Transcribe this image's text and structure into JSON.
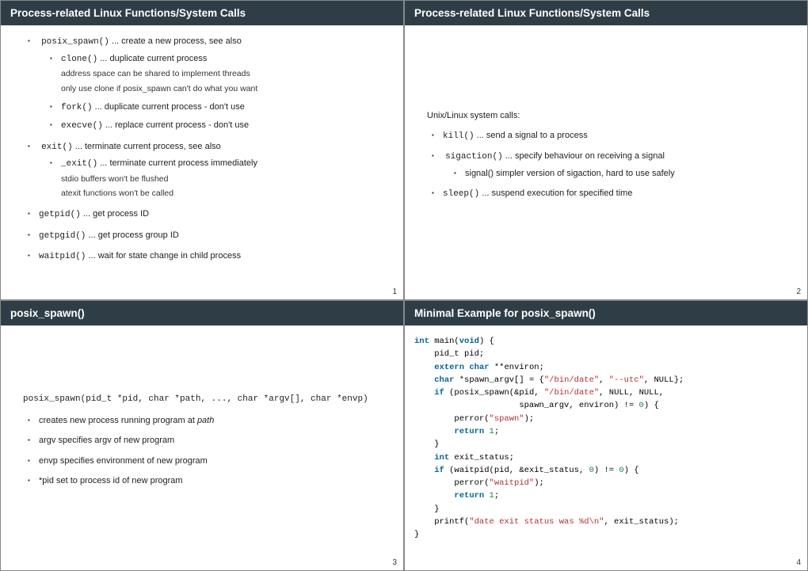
{
  "slide1": {
    "title": "Process-related Linux Functions/System Calls",
    "pagenum": "1",
    "i1_fn": "posix_spawn()",
    "i1_rest": " ... create a new process, see also",
    "i1a_fn": "clone()",
    "i1a_rest": " ... duplicate current process",
    "i1a_n1": "address space can be shared to implement threads",
    "i1a_n2": "only use clone if posix_spawn can't do what you want",
    "i1b_fn": "fork()",
    "i1b_rest": " ... duplicate current process - don't use",
    "i1c_fn": "execve()",
    "i1c_rest": " ... replace current process - don't use",
    "i2_fn": "exit()",
    "i2_rest": " ... terminate current process, see also",
    "i2a_fn": "_exit()",
    "i2a_rest": " ... terminate current process immediately",
    "i2a_n1": "stdio buffers won't be flushed",
    "i2a_n2": "atexit functions won't be called",
    "i3_fn": "getpid()",
    "i3_rest": " ... get process ID",
    "i4_fn": "getpgid()",
    "i4_rest": " ... get process group ID",
    "i5_fn": "waitpid()",
    "i5_rest": " ... wait for state change in child process"
  },
  "slide2": {
    "title": "Process-related Linux Functions/System Calls",
    "pagenum": "2",
    "intro": "Unix/Linux system calls:",
    "i1_fn": "kill()",
    "i1_rest": " ... send a signal to a process",
    "i2_fn": "sigaction()",
    "i2_rest": " ... specify behaviour on receiving a signal",
    "i2a": "signal() simpler version of sigaction, hard to use safely",
    "i3_fn": "sleep()",
    "i3_rest": " ... suspend execution for specified time"
  },
  "slide3": {
    "title": "posix_spawn()",
    "pagenum": "3",
    "sig": "posix_spawn(pid_t *pid, char *path, ..., char *argv[], char *envp)",
    "b1_a": "creates new process running program at ",
    "b1_b": "path",
    "b2": "argv specifies argv of new program",
    "b3": "envp specifies environment of new program",
    "b4": "*pid set to process id of new program"
  },
  "slide4": {
    "title": "Minimal Example for posix_spawn()",
    "pagenum": "4",
    "c01a": "int",
    "c01b": " main(",
    "c01c": "void",
    "c01d": ") {",
    "c02": "    pid_t pid;",
    "c03a": "    ",
    "c03b": "extern",
    "c03c": " ",
    "c03d": "char",
    "c03e": " **environ;",
    "c04a": "    ",
    "c04b": "char",
    "c04c": " *spawn_argv[] = {",
    "c04d": "\"/bin/date\"",
    "c04e": ", ",
    "c04f": "\"--utc\"",
    "c04g": ", NULL};",
    "c05a": "    ",
    "c05b": "if",
    "c05c": " (posix_spawn(&pid, ",
    "c05d": "\"/bin/date\"",
    "c05e": ", NULL, NULL,",
    "c06a": "                     spawn_argv, environ) != ",
    "c06b": "0",
    "c06c": ") {",
    "c07a": "        perror(",
    "c07b": "\"spawn\"",
    "c07c": ");",
    "c08a": "        ",
    "c08b": "return",
    "c08c": " ",
    "c08d": "1",
    "c08e": ";",
    "c09": "    }",
    "c10a": "    ",
    "c10b": "int",
    "c10c": " exit_status;",
    "c11a": "    ",
    "c11b": "if",
    "c11c": " (waitpid(pid, &exit_status, ",
    "c11d": "0",
    "c11e": ") != ",
    "c11f": "0",
    "c11g": ") {",
    "c12a": "        perror(",
    "c12b": "\"waitpid\"",
    "c12c": ");",
    "c13a": "        ",
    "c13b": "return",
    "c13c": " ",
    "c13d": "1",
    "c13e": ";",
    "c14": "    }",
    "c15a": "    printf(",
    "c15b": "\"date exit status was %d\\n\"",
    "c15c": ", exit_status);",
    "c16": "}"
  }
}
